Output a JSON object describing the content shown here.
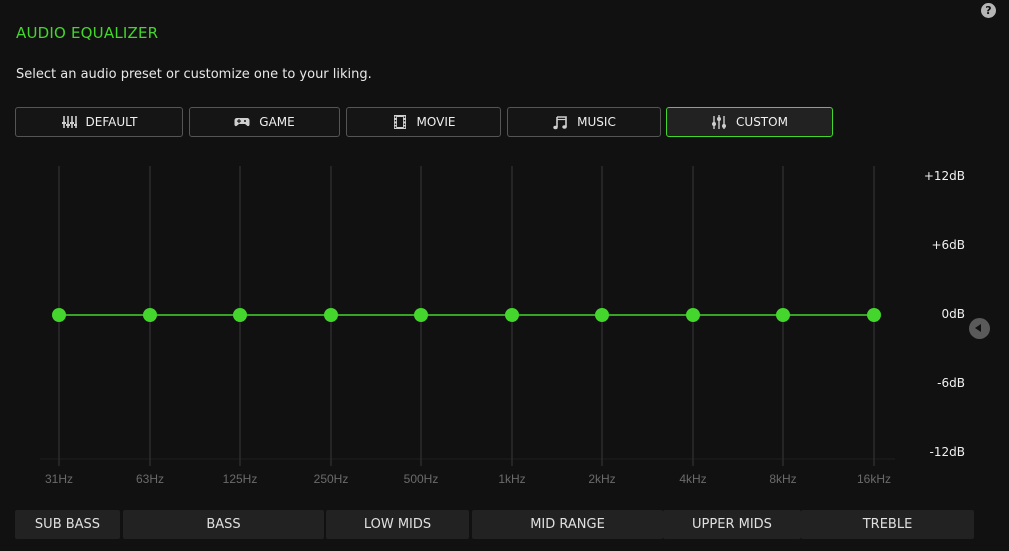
{
  "header": {
    "title": "AUDIO EQUALIZER",
    "subtitle": "Select an audio preset or customize one to your liking.",
    "help_icon": "question-circle-icon"
  },
  "presets": [
    {
      "label": "DEFAULT",
      "icon": "equalizer-bars-icon",
      "active": false
    },
    {
      "label": "GAME",
      "icon": "gamepad-icon",
      "active": false
    },
    {
      "label": "MOVIE",
      "icon": "film-strip-icon",
      "active": false
    },
    {
      "label": "MUSIC",
      "icon": "music-note-icon",
      "active": false
    },
    {
      "label": "CUSTOM",
      "icon": "sliders-icon",
      "active": true
    }
  ],
  "equalizer": {
    "db_labels": [
      "+12dB",
      "+6dB",
      "0dB",
      "-6dB",
      "-12dB"
    ],
    "db_range": [
      -12,
      12
    ],
    "bands": [
      {
        "freq": "31Hz",
        "gain_db": 0
      },
      {
        "freq": "63Hz",
        "gain_db": 0
      },
      {
        "freq": "125Hz",
        "gain_db": 0
      },
      {
        "freq": "250Hz",
        "gain_db": 0
      },
      {
        "freq": "500Hz",
        "gain_db": 0
      },
      {
        "freq": "1kHz",
        "gain_db": 0
      },
      {
        "freq": "2kHz",
        "gain_db": 0
      },
      {
        "freq": "4kHz",
        "gain_db": 0
      },
      {
        "freq": "8kHz",
        "gain_db": 0
      },
      {
        "freq": "16kHz",
        "gain_db": 0
      }
    ],
    "curve_color": "#44d62c",
    "collapse_icon": "chevron-left-icon"
  },
  "band_groups": [
    "SUB BASS",
    "BASS",
    "LOW MIDS",
    "MID RANGE",
    "UPPER MIDS",
    "TREBLE"
  ],
  "colors": {
    "accent": "#44d62c",
    "background": "#111111"
  }
}
